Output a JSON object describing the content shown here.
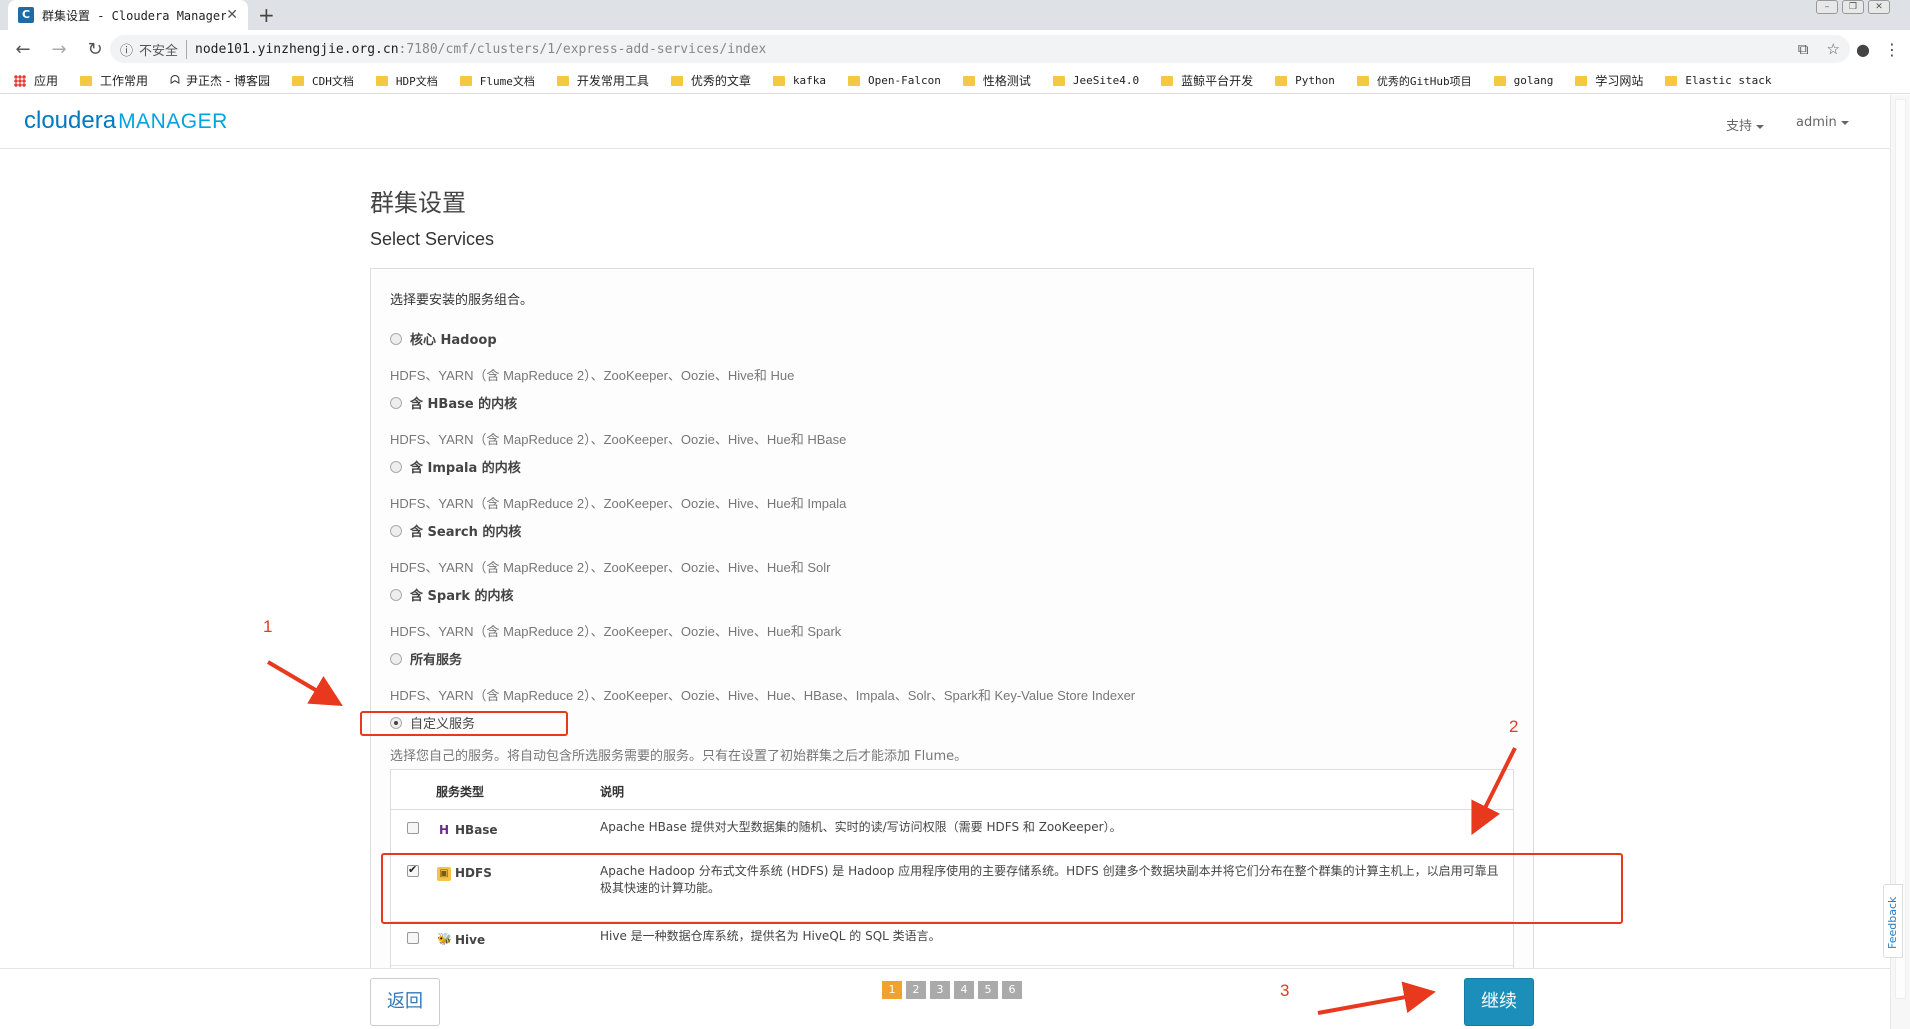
{
  "browser": {
    "tab_title": "群集设置 - Cloudera Manager",
    "tab_favicon": "C",
    "new_tab": "+",
    "insecure": "不安全",
    "url_host": "node101.yinzhengjie.org.cn",
    "url_path": ":7180/cmf/clusters/1/express-add-services/index",
    "bookmarks": [
      "应用",
      "工作常用",
      "尹正杰 - 博客园",
      "CDH文档",
      "HDP文档",
      "Flume文档",
      "开发常用工具",
      "优秀的文章",
      "kafka",
      "Open-Falcon",
      "性格测试",
      "JeeSite4.0",
      "蓝鲸平台开发",
      "Python",
      "优秀的GitHub项目",
      "golang",
      "学习网站",
      "Elastic stack"
    ]
  },
  "header": {
    "logo_cloudera": "cloudera",
    "logo_manager": "MANAGER",
    "support": "支持",
    "user": "admin"
  },
  "page": {
    "title": "群集设置",
    "subtitle": "Select Services",
    "intro": "选择要安装的服务组合。",
    "options": [
      {
        "label": "核心 Hadoop",
        "desc": "HDFS、YARN（含 MapReduce 2）、ZooKeeper、Oozie、Hive和 Hue",
        "selected": false
      },
      {
        "label": "含 HBase 的内核",
        "desc": "HDFS、YARN（含 MapReduce 2）、ZooKeeper、Oozie、Hive、Hue和 HBase",
        "selected": false
      },
      {
        "label": "含 Impala 的内核",
        "desc": "HDFS、YARN（含 MapReduce 2）、ZooKeeper、Oozie、Hive、Hue和 Impala",
        "selected": false
      },
      {
        "label": "含 Search 的内核",
        "desc": "HDFS、YARN（含 MapReduce 2）、ZooKeeper、Oozie、Hive、Hue和 Solr",
        "selected": false
      },
      {
        "label": "含 Spark 的内核",
        "desc": "HDFS、YARN（含 MapReduce 2）、ZooKeeper、Oozie、Hive、Hue和 Spark",
        "selected": false
      },
      {
        "label": "所有服务",
        "desc": "HDFS、YARN（含 MapReduce 2）、ZooKeeper、Oozie、Hive、Hue、HBase、Impala、Solr、Spark和 Key-Value Store Indexer",
        "selected": false
      }
    ],
    "custom": {
      "label": "自定义服务",
      "selected": true,
      "desc": "选择您自己的服务。将自动包含所选服务需要的服务。只有在设置了初始群集之后才能添加 Flume。"
    },
    "table": {
      "col_type": "服务类型",
      "col_desc": "说明",
      "rows": [
        {
          "name": "HBase",
          "icon": "hbase-icon",
          "checked": false,
          "desc": "Apache HBase 提供对大型数据集的随机、实时的读/写访问权限（需要 HDFS 和 ZooKeeper）。"
        },
        {
          "name": "HDFS",
          "icon": "hdfs-icon",
          "checked": true,
          "desc": "Apache Hadoop 分布式文件系统 (HDFS) 是 Hadoop 应用程序使用的主要存储系统。HDFS 创建多个数据块副本并将它们分布在整个群集的计算主机上，以启用可靠且极其快速的计算功能。"
        },
        {
          "name": "Hive",
          "icon": "hive-icon",
          "checked": false,
          "desc": "Hive 是一种数据仓库系统，提供名为 HiveQL 的 SQL 类语言。"
        }
      ]
    }
  },
  "footer": {
    "back": "返回",
    "continue": "继续",
    "steps": [
      "1",
      "2",
      "3",
      "4",
      "5",
      "6"
    ],
    "active_step": "1"
  },
  "feedback": "Feedback",
  "annotations": [
    "1",
    "2",
    "3"
  ],
  "colors": {
    "accent": "#1b8fba",
    "annotation": "#e8391f",
    "step_active": "#f0a12e"
  }
}
